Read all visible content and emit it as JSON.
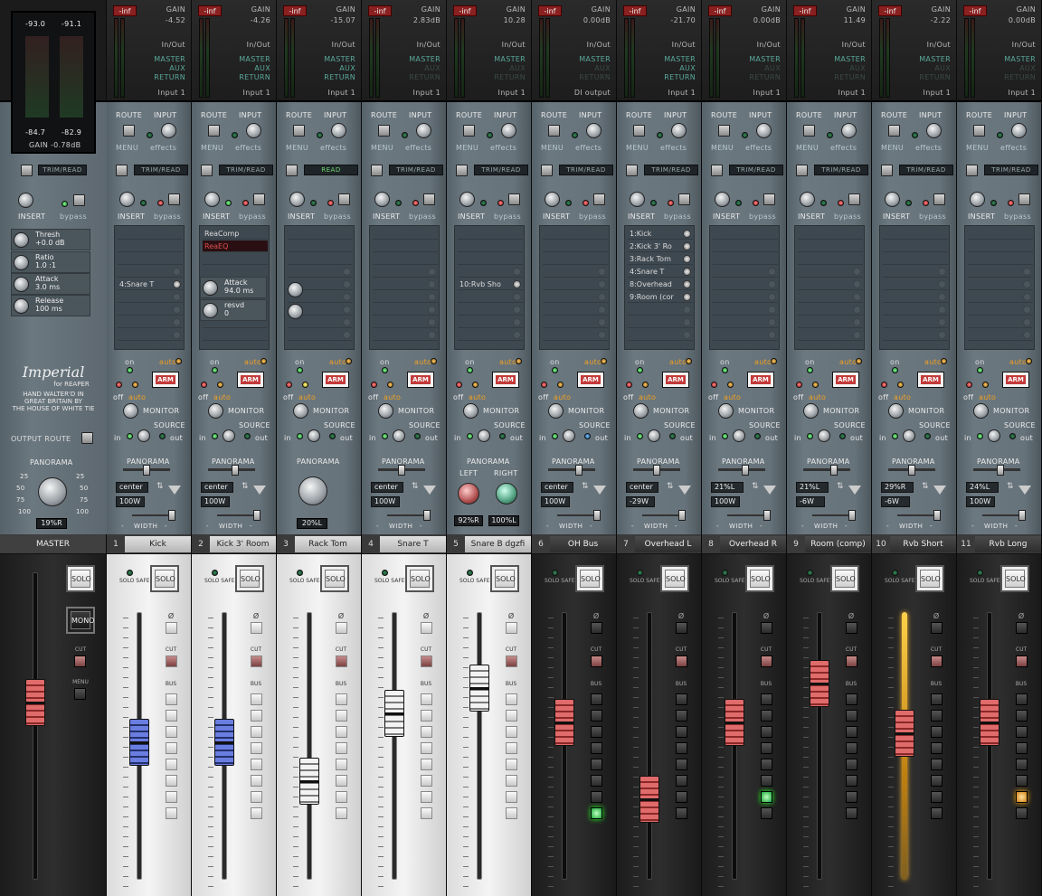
{
  "master": {
    "meter_top_left": "-93.0",
    "meter_top_right": "-91.1",
    "meter_bot_left": "-84.7",
    "meter_bot_right": "-82.9",
    "gain_label": "GAIN",
    "gain_value": "-0.78dB",
    "trim_mode": "TRIM/READ",
    "insert": "INSERT",
    "bypass": "bypass",
    "plugins": [
      {
        "name": "Thresh",
        "value": "+0.0 dB"
      },
      {
        "name": "Ratio",
        "value": "1.0 :1"
      },
      {
        "name": "Attack",
        "value": "3.0 ms"
      },
      {
        "name": "Release",
        "value": "100 ms"
      }
    ],
    "brand_line1": "Imperial",
    "brand_line2": "for REAPER",
    "brand_line3": "HAND WALTER'D IN",
    "brand_line4": "GREAT BRITAIN BY",
    "brand_line5": "THE HOUSE OF WHITE TIE",
    "output_route": "OUTPUT ROUTE",
    "panorama": "PANORAMA",
    "pan_value": "19%R",
    "scale": {
      "l25": "25",
      "l50": "50",
      "l75": "75",
      "l100": "100",
      "r25": "25",
      "r50": "50",
      "r75": "75",
      "r100": "100"
    },
    "name": "MASTER",
    "solo": "SOLO",
    "mono": "MONO",
    "cut": "CUT",
    "menu": "MENU"
  },
  "labels": {
    "inf": "-inf",
    "gain": "GAIN",
    "inout": "In/Out",
    "master": "MASTER",
    "aux": "AUX",
    "return": "RETURN",
    "route": "ROUTE",
    "input": "INPUT",
    "menu": "MENU",
    "effects": "effects",
    "insert": "INSERT",
    "bypass": "bypass",
    "on": "on",
    "auto": "auto",
    "off": "off",
    "arm": "ARM",
    "monitor": "MONITOR",
    "source": "SOURCE",
    "in": "in",
    "out": "out",
    "panorama": "PANORAMA",
    "width": "WIDTH",
    "left": "LEFT",
    "right": "RIGHT",
    "solo": "SOLO",
    "solo_safe": "SOLO SAFE",
    "phase": "Ø",
    "cut": "CUT",
    "bus": "BUS",
    "dash": "-"
  },
  "tracks": [
    {
      "num": "1",
      "name": "Kick",
      "gain": "-4.52",
      "input": "Input 1",
      "trim": "TRIM/READ",
      "fx": [
        "",
        "",
        "",
        "",
        "4:Snare T",
        "",
        ""
      ],
      "pan": "center",
      "width": "100W",
      "theme": "light",
      "fader": "blue"
    },
    {
      "num": "2",
      "name": "Kick 3' Room",
      "gain": "-4.26",
      "input": "Input 1",
      "trim": "TRIM/READ",
      "fx": [
        "ReaComp",
        "ReaEQ"
      ],
      "params": [
        {
          "n": "Attack",
          "v": "94.0 ms"
        },
        {
          "n": "resvd",
          "v": "0"
        }
      ],
      "pan": "center",
      "width": "100W",
      "theme": "light",
      "fader": "blue"
    },
    {
      "num": "3",
      "name": "Rack Tom",
      "gain": "-15.07",
      "input": "Input 1",
      "trim": "READ",
      "fx": [],
      "pan": "20%L",
      "theme": "light",
      "fader": "grey"
    },
    {
      "num": "4",
      "name": "Snare T",
      "gain": "2.83dB",
      "input": "Input 1",
      "trim": "TRIM/READ",
      "fx": [],
      "pan": "center",
      "width": "100W",
      "theme": "light",
      "fader": "grey"
    },
    {
      "num": "5",
      "name": "Snare B dgzfi",
      "gain": "10.28",
      "input": "Input 1",
      "trim": "TRIM/READ",
      "fx": [
        "",
        "",
        "",
        "",
        "10:Rvb Sho",
        "",
        ""
      ],
      "pan_left": "92%R",
      "pan_right": "100%L",
      "theme": "light",
      "fader": "grey"
    },
    {
      "num": "6",
      "name": "OH Bus",
      "gain": "0.00dB",
      "input": "DI output",
      "trim": "TRIM/READ",
      "fx": [],
      "pan": "center",
      "width": "100W",
      "theme": "dark",
      "fader": "red"
    },
    {
      "num": "7",
      "name": "Overhead L",
      "gain": "-21.70",
      "input": "Input 1",
      "trim": "TRIM/READ",
      "fx": [
        "1:Kick",
        "2:Kick 3' Ro",
        "3:Rack Tom",
        "4:Snare T",
        "8:Overhead",
        "9:Room (cor"
      ],
      "pan": "center",
      "width": "-29W",
      "theme": "dark",
      "fader": "red"
    },
    {
      "num": "8",
      "name": "Overhead R",
      "gain": "0.00dB",
      "input": "Input 1",
      "trim": "TRIM/READ",
      "fx": [],
      "pan": "21%L",
      "width": "100W",
      "theme": "dark",
      "fader": "red"
    },
    {
      "num": "9",
      "name": "Room (comp)",
      "gain": "11.49",
      "input": "Input 1",
      "trim": "TRIM/READ",
      "fx": [],
      "pan": "21%L",
      "width": "-6W",
      "theme": "dark",
      "fader": "red"
    },
    {
      "num": "10",
      "name": "Rvb Short",
      "gain": "-2.22",
      "input": "Input 1",
      "trim": "TRIM/READ",
      "fx": [],
      "pan": "29%R",
      "width": "-6W",
      "theme": "dark",
      "fader": "red"
    },
    {
      "num": "11",
      "name": "Rvb Long",
      "gain": "0.00dB",
      "input": "Input 1",
      "trim": "TRIM/READ",
      "fx": [],
      "pan": "24%L",
      "width": "100W",
      "theme": "dark",
      "fader": "red"
    }
  ],
  "colors": {
    "accent_teal": "#5aa89a",
    "arm_red": "#c43a3a",
    "led_green": "#19a83a",
    "glow_orange": "#ffb030"
  }
}
